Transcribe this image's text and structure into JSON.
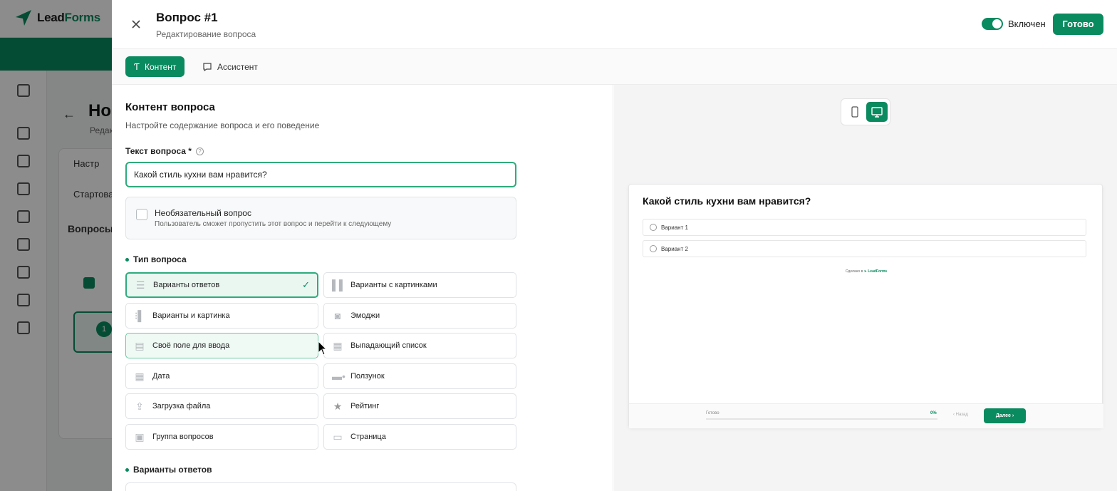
{
  "background_app": {
    "logo": {
      "part1": "Lead",
      "part2": "Forms"
    },
    "page_title": "Но",
    "page_subtitle": "Редак",
    "card_items": [
      "Настр",
      "Стартова",
      "Вопросы"
    ],
    "question_number": "1"
  },
  "drawer": {
    "title": "Вопрос #1",
    "subtitle": "Редактирование вопроса",
    "toggle": {
      "label": "Включен",
      "on": true
    },
    "done_label": "Готово",
    "tabs": [
      {
        "label": "Контент",
        "icon": "text-icon",
        "active": true
      },
      {
        "label": "Ассистент",
        "icon": "chat-icon",
        "active": false
      }
    ]
  },
  "content": {
    "section_title": "Контент вопроса",
    "section_desc": "Настройте содержание вопроса и его поведение",
    "question_label": "Текст вопроса *",
    "question_value": "Какой стиль кухни вам нравится?",
    "optional": {
      "checked": false,
      "title": "Необязательный вопрос",
      "desc": "Пользователь сможет пропустить этот вопрос и перейти к следующему"
    },
    "type_label": "Тип вопроса",
    "types": [
      {
        "label": "Варианты ответов",
        "icon": "list-icon",
        "selected": true
      },
      {
        "label": "Варианты с картинками",
        "icon": "image-columns-icon",
        "selected": false
      },
      {
        "label": "Варианты и картинка",
        "icon": "list-image-icon",
        "selected": false
      },
      {
        "label": "Эмоджи",
        "icon": "emoji-icon",
        "selected": false
      },
      {
        "label": "Своё поле для ввода",
        "icon": "text-field-icon",
        "selected": false
      },
      {
        "label": "Выпадающий список",
        "icon": "dropdown-icon",
        "selected": false
      },
      {
        "label": "Дата",
        "icon": "calendar-icon",
        "selected": false
      },
      {
        "label": "Ползунок",
        "icon": "slider-icon",
        "selected": false
      },
      {
        "label": "Загрузка файла",
        "icon": "upload-icon",
        "selected": false
      },
      {
        "label": "Рейтинг",
        "icon": "star-icon",
        "selected": false
      },
      {
        "label": "Группа вопросов",
        "icon": "group-icon",
        "selected": false
      },
      {
        "label": "Страница",
        "icon": "page-icon",
        "selected": false
      }
    ],
    "answers_label": "Варианты ответов"
  },
  "preview": {
    "device": "desktop",
    "title": "Какой стиль кухни вам нравится?",
    "options": [
      "Вариант 1",
      "Вариант 2"
    ],
    "made_with_prefix": "Сделано в",
    "made_with_brand": "LeadForms",
    "progress_label": "Готово",
    "progress_percent": "0%",
    "back_label": "Назад",
    "next_label": "Далее"
  },
  "colors": {
    "accent": "#0a8a5f",
    "accent_light": "#eaf7f1",
    "border": "#dfe2e6"
  }
}
